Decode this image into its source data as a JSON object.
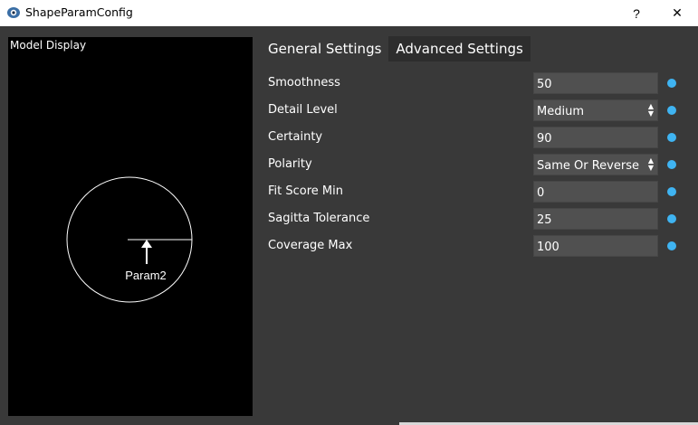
{
  "window": {
    "title": "ShapeParamConfig",
    "help_label": "?",
    "close_label": "✕"
  },
  "model_display": {
    "label": "Model Display",
    "param_label": "Param2"
  },
  "tabs": [
    {
      "label": "General Settings",
      "active": true
    },
    {
      "label": "Advanced Settings",
      "active": false
    }
  ],
  "params": [
    {
      "label": "Smoothness",
      "value": "50",
      "type": "input"
    },
    {
      "label": "Detail Level",
      "value": "Medium",
      "type": "select"
    },
    {
      "label": "Certainty",
      "value": "90",
      "type": "input"
    },
    {
      "label": "Polarity",
      "value": "Same Or Reverse",
      "type": "select"
    },
    {
      "label": "Fit Score Min",
      "value": "0",
      "type": "input"
    },
    {
      "label": "Sagitta Tolerance",
      "value": "25",
      "type": "input"
    },
    {
      "label": "Coverage Max",
      "value": "100",
      "type": "input"
    }
  ],
  "colors": {
    "background": "#393939",
    "field": "#505050",
    "indicator": "#3fb4f2"
  }
}
